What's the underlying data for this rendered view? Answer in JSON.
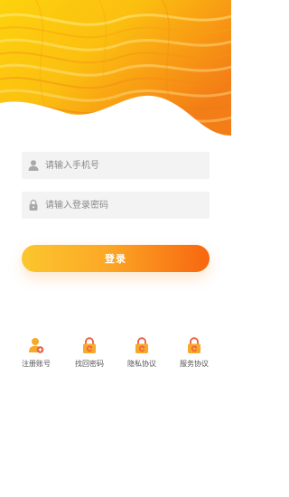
{
  "login_form": {
    "phone_placeholder": "请输入手机号",
    "password_placeholder": "请输入登录密码",
    "phone_icon": "user-icon",
    "password_icon": "lock-icon",
    "submit_label": "登录"
  },
  "footer_links": [
    {
      "label": "注册账号",
      "icon": "user-add-icon"
    },
    {
      "label": "找回密码",
      "icon": "lock-reset-icon"
    },
    {
      "label": "隐私协议",
      "icon": "lock-reset-icon"
    },
    {
      "label": "服务协议",
      "icon": "lock-reset-icon"
    }
  ],
  "colors": {
    "accent_start": "#fcc62e",
    "accent_end": "#f8660f",
    "input_background": "#f3f3f4",
    "icon_gold": "#f7a92c",
    "icon_red": "#ee5a3a"
  }
}
